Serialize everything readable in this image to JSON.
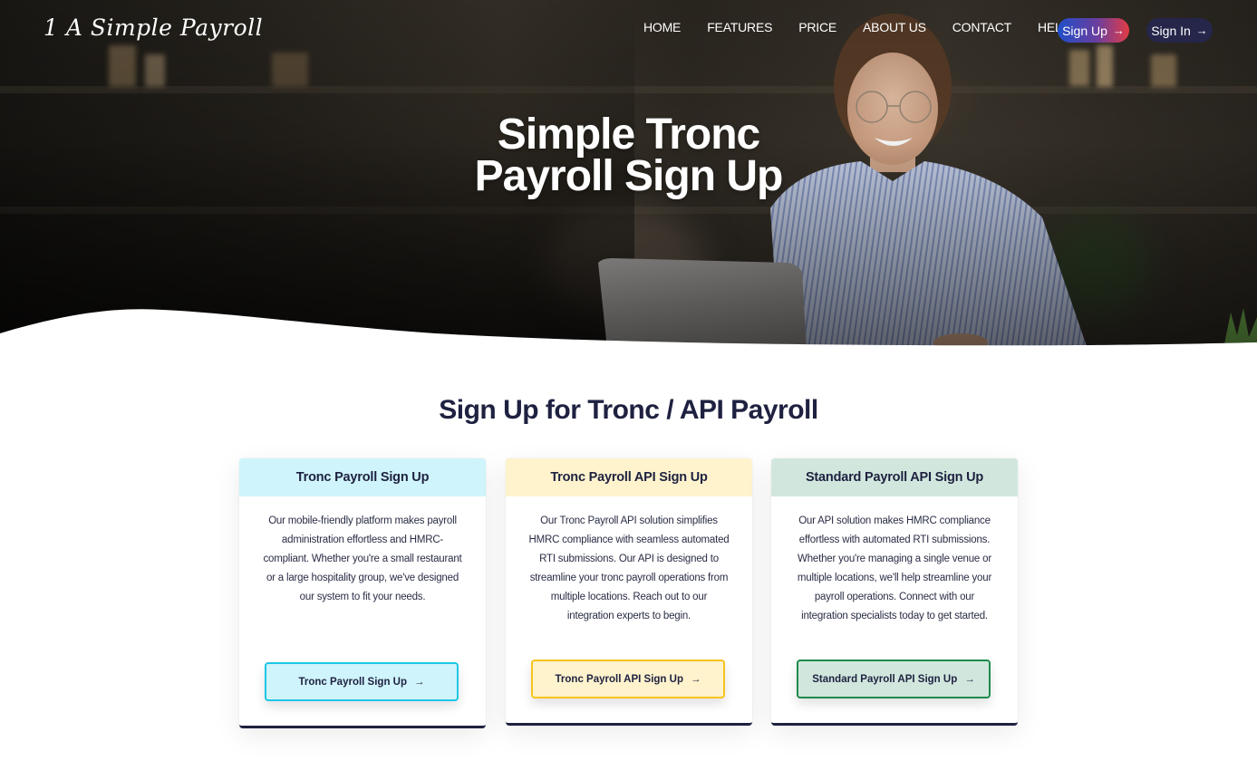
{
  "brand": {
    "logo_text": "1 A Simple Payroll"
  },
  "nav": {
    "items": [
      {
        "label": "HOME"
      },
      {
        "label": "FEATURES"
      },
      {
        "label": "PRICE"
      },
      {
        "label": "ABOUT US"
      },
      {
        "label": "CONTACT"
      },
      {
        "label": "HELP"
      }
    ],
    "signup_label": "Sign Up",
    "signin_label": "Sign In",
    "arrow_icon": "→"
  },
  "hero": {
    "title_line1": "Simple Tronc",
    "title_line2": "Payroll Sign Up"
  },
  "section": {
    "title": "Sign Up for Tronc / API Payroll"
  },
  "cards": [
    {
      "title": "Tronc Payroll Sign Up",
      "text": "Our mobile-friendly platform makes payroll administration effortless and HMRC-compliant. Whether you're a small restaurant or a large hospitality group, we've designed our system to fit your needs.",
      "button_label": "Tronc Payroll Sign Up",
      "accent": "#1ec7e6",
      "tint": "#cff4fb"
    },
    {
      "title": "Tronc Payroll API Sign Up",
      "text": "Our Tronc Payroll API solution simplifies HMRC compliance with seamless automated RTI submissions. Our API is designed to streamline your tronc payroll operations from multiple locations. Reach out to our integration experts to begin.",
      "button_label": "Tronc Payroll API Sign Up",
      "accent": "#f8c31e",
      "tint": "#fff3cd"
    },
    {
      "title": "Standard Payroll API Sign Up",
      "text": "Our API solution makes HMRC compliance effortless with automated RTI submissions. Whether you're managing a single venue or multiple locations, we'll help streamline your payroll operations. Connect with our integration specialists today to get started.",
      "button_label": "Standard Payroll API Sign Up",
      "accent": "#1f8a4c",
      "tint": "#d1e7dd"
    }
  ],
  "colors": {
    "navy": "#1e2140",
    "signin_bg": "#25264a",
    "signup_gradient_start": "#1e4fc9",
    "signup_gradient_end": "#e23c45"
  }
}
